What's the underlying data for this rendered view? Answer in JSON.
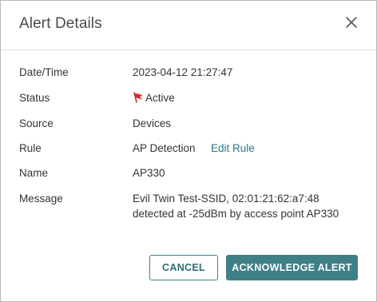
{
  "dialog": {
    "title": "Alert Details",
    "close_icon": "close-icon"
  },
  "fields": {
    "datetime_label": "Date/Time",
    "datetime_value": "2023-04-12 21:27:47",
    "status_label": "Status",
    "status_value": "Active",
    "status_icon": "red-flag-icon",
    "status_icon_color": "#e0242a",
    "source_label": "Source",
    "source_value": "Devices",
    "rule_label": "Rule",
    "rule_value": "AP Detection",
    "rule_link": "Edit Rule",
    "name_label": "Name",
    "name_value": "AP330",
    "message_label": "Message",
    "message_value": "Evil Twin Test-SSID, 02:01:21:62:a7:48 detected at -25dBm by access point AP330"
  },
  "actions": {
    "cancel_label": "CANCEL",
    "acknowledge_label": "ACKNOWLEDGE ALERT"
  },
  "colors": {
    "accent": "#3f7f88",
    "link": "#2e7a85",
    "flag": "#e0242a"
  }
}
